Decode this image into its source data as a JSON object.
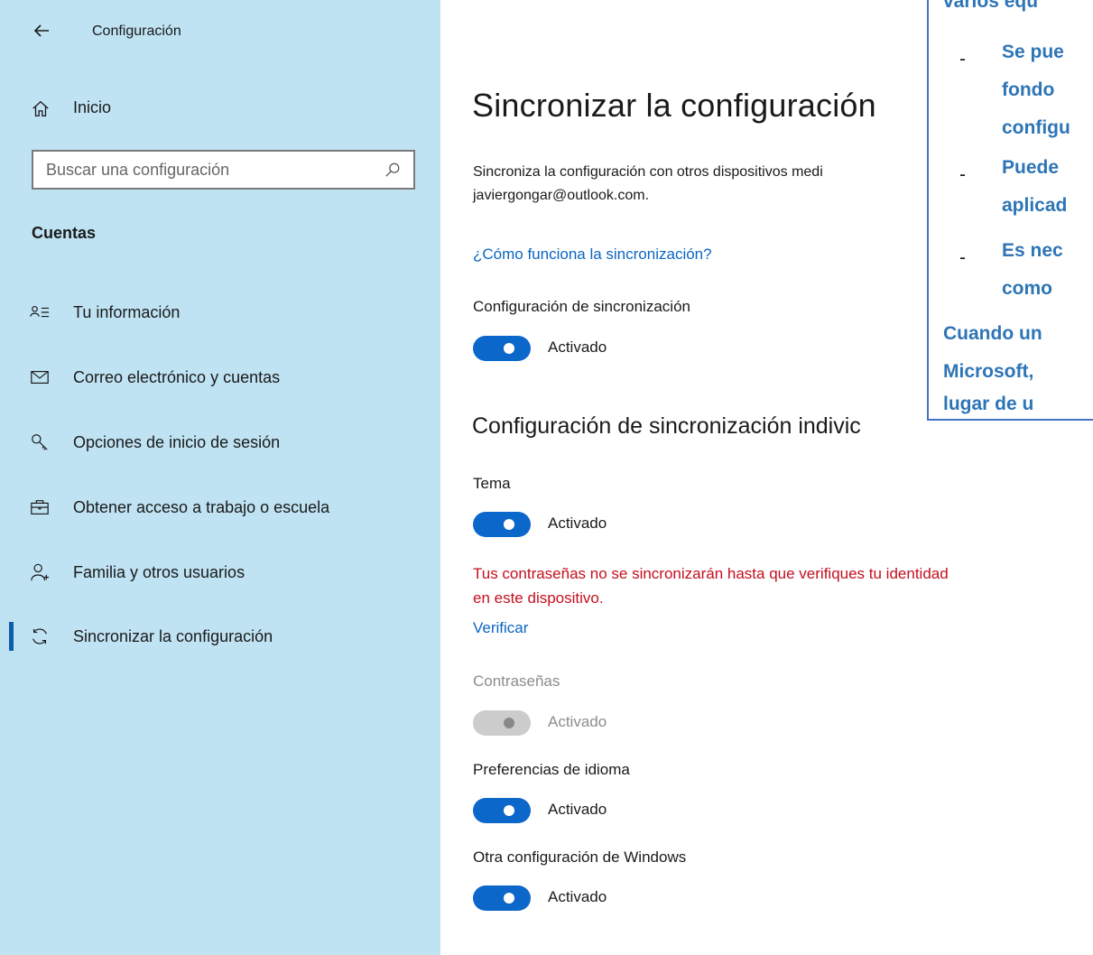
{
  "window": {
    "back_label": "←",
    "title": "Configuración"
  },
  "sidebar": {
    "home_label": "Inicio",
    "search_placeholder": "Buscar una configuración",
    "section_label": "Cuentas",
    "items": [
      {
        "label": "Tu información",
        "icon": "person-list-icon"
      },
      {
        "label": "Correo electrónico y cuentas",
        "icon": "mail-icon"
      },
      {
        "label": "Opciones de inicio de sesión",
        "icon": "key-icon"
      },
      {
        "label": "Obtener acceso a trabajo o escuela",
        "icon": "briefcase-icon"
      },
      {
        "label": "Familia y otros usuarios",
        "icon": "person-add-icon"
      },
      {
        "label": "Sincronizar la configuración",
        "icon": "sync-icon",
        "active": true
      }
    ]
  },
  "main": {
    "title": "Sincronizar la configuración",
    "description_line1": "Sincroniza la configuración con otros dispositivos medi",
    "description_line2": "javiergongar@outlook.com.",
    "how_link": "¿Cómo funciona la sincronización?",
    "sync_label": "Configuración de sincronización",
    "sync_state": "Activado",
    "individual_title": "Configuración de sincronización indivic",
    "theme_label": "Tema",
    "theme_state": "Activado",
    "warning_line1": "Tus contraseñas no se sincronizarán hasta que verifiques tu identidad",
    "warning_line2": "en este dispositivo.",
    "verify_link": "Verificar",
    "passwords_label": "Contraseñas",
    "passwords_state": "Activado",
    "language_label": "Preferencias de idioma",
    "language_state": "Activado",
    "other_label": "Otra configuración de Windows",
    "other_state": "Activado"
  },
  "callout": {
    "line1": "varios equ",
    "bullet1_line1": "Se pue",
    "bullet1_line2": "fondo",
    "bullet1_line3": "configu",
    "bullet2_line1": "Puede",
    "bullet2_line2": "aplicad",
    "bullet3_line1": "Es nec",
    "bullet3_line2": "como",
    "para_line1": "Cuando un",
    "para_line2": "Microsoft,",
    "para_line3": "lugar de u",
    "dash": "-"
  },
  "colors": {
    "sidebar_bg": "#bfe3f3",
    "accent": "#0b67c9",
    "link": "#0b66c2",
    "warning": "#c50f1f",
    "callout_text": "#2e75b6",
    "callout_border": "#4472c4"
  }
}
